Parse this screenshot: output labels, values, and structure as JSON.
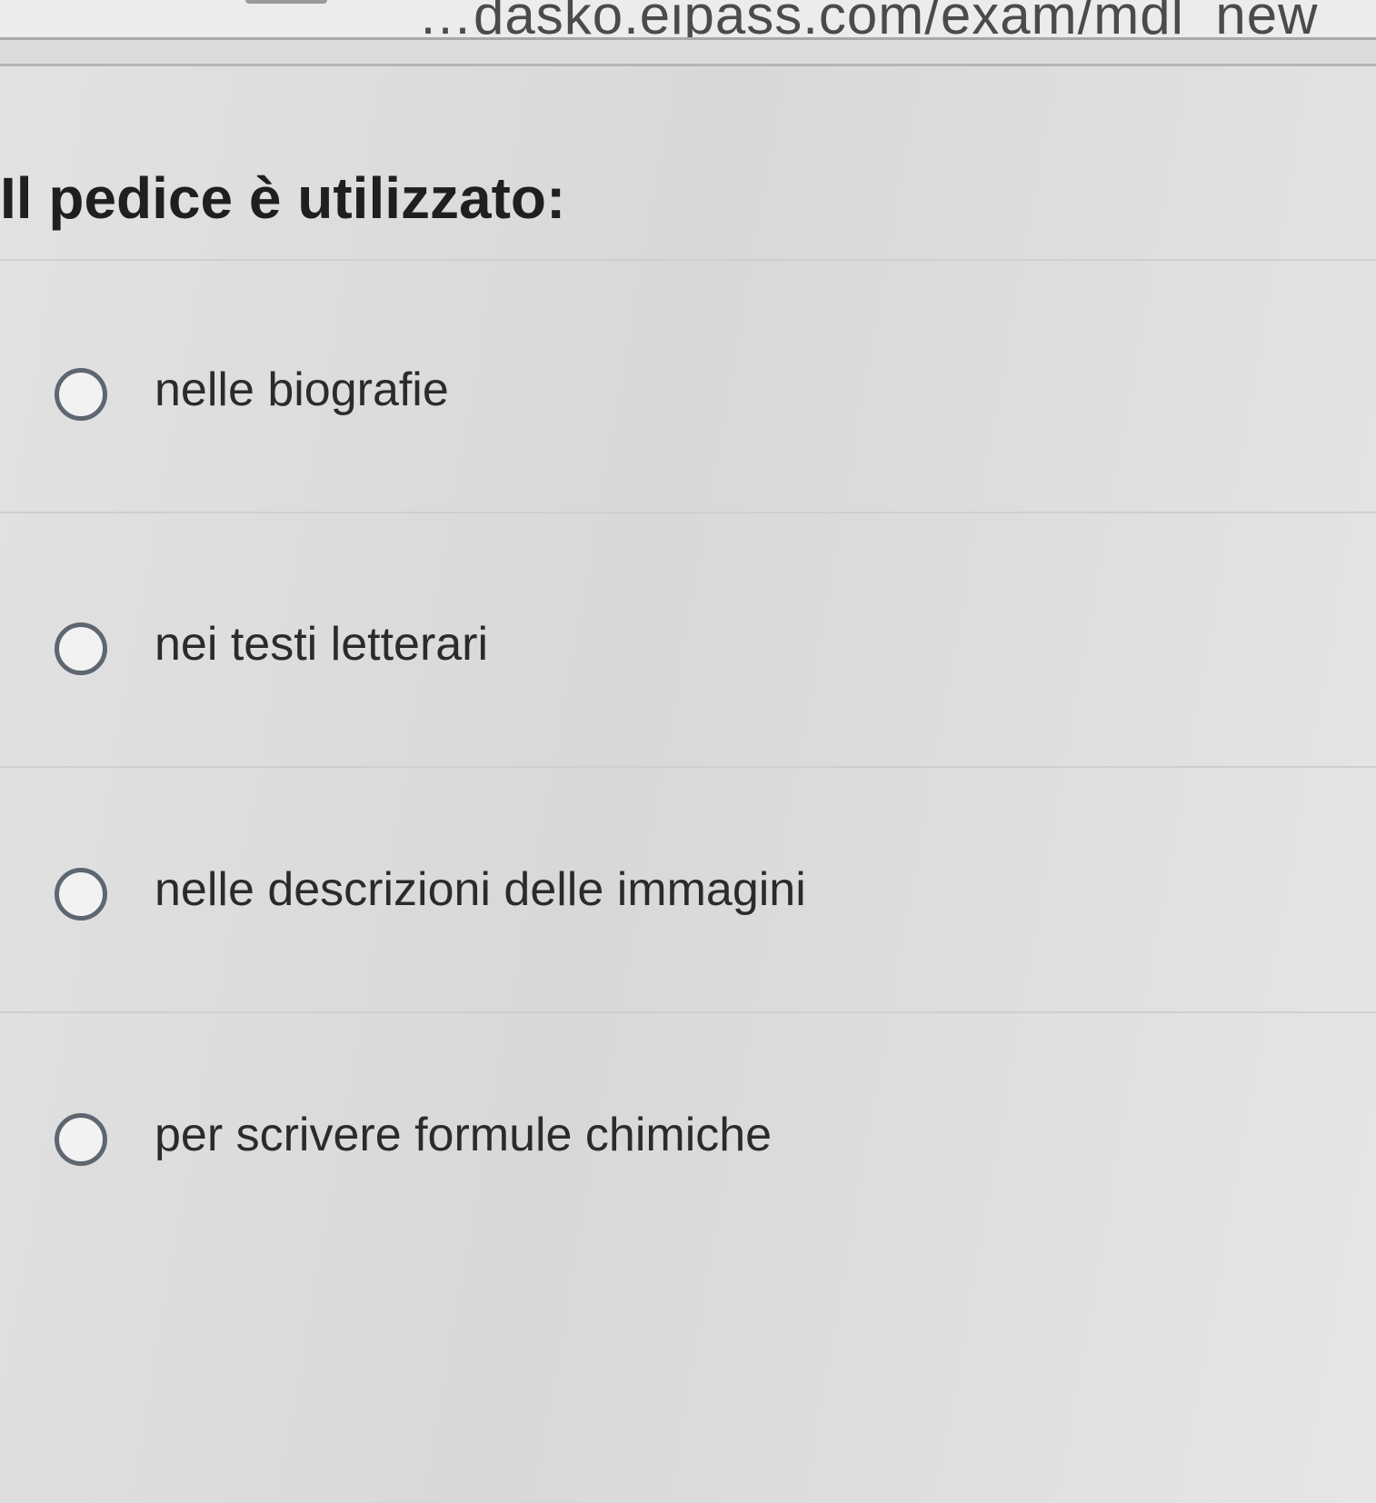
{
  "browser": {
    "url": "…dasko.eipass.com/exam/mdl_new"
  },
  "question": {
    "text": "Il pedice è utilizzato:"
  },
  "options": [
    {
      "label": "nelle biografie",
      "selected": false
    },
    {
      "label": "nei testi letterari",
      "selected": false
    },
    {
      "label": "nelle descrizioni delle immagini",
      "selected": false
    },
    {
      "label": "per scrivere formule chimiche",
      "selected": false
    }
  ],
  "colors": {
    "background": "#dcdcdc",
    "radio_border": "#5e6670",
    "text": "#2b2b2b"
  }
}
